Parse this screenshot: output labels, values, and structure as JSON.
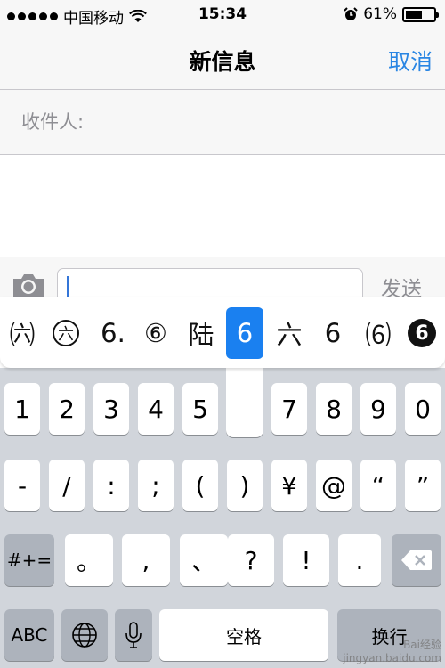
{
  "status_bar": {
    "carrier": "中国移动",
    "time": "15:34",
    "battery": "61%",
    "battery_level": 0.61
  },
  "nav": {
    "title": "新信息",
    "cancel": "取消"
  },
  "recipient": {
    "label": "收件人:"
  },
  "input": {
    "send": "发送"
  },
  "candidates": [
    "㈥",
    "六",
    "6.",
    "⑥",
    "陆",
    "6",
    "六",
    "6",
    "⑹",
    "6"
  ],
  "keyboard": {
    "row1": [
      "1",
      "2",
      "3",
      "4",
      "5",
      "6",
      "7",
      "8",
      "9",
      "0"
    ],
    "row2": [
      "-",
      "/",
      ":",
      ";",
      "(",
      ")",
      "¥",
      "@",
      "“",
      "”"
    ],
    "row3": [
      "#+=",
      "。",
      ",",
      "、",
      "?",
      "!",
      "."
    ],
    "row4": {
      "abc": "ABC",
      "space": "空格",
      "return": "换行"
    }
  },
  "watermark": {
    "line1": "Bai经验",
    "line2": "jingyan.baidu.com"
  },
  "colors": {
    "accent": "#2a86e3",
    "selected": "#1a80f0"
  }
}
